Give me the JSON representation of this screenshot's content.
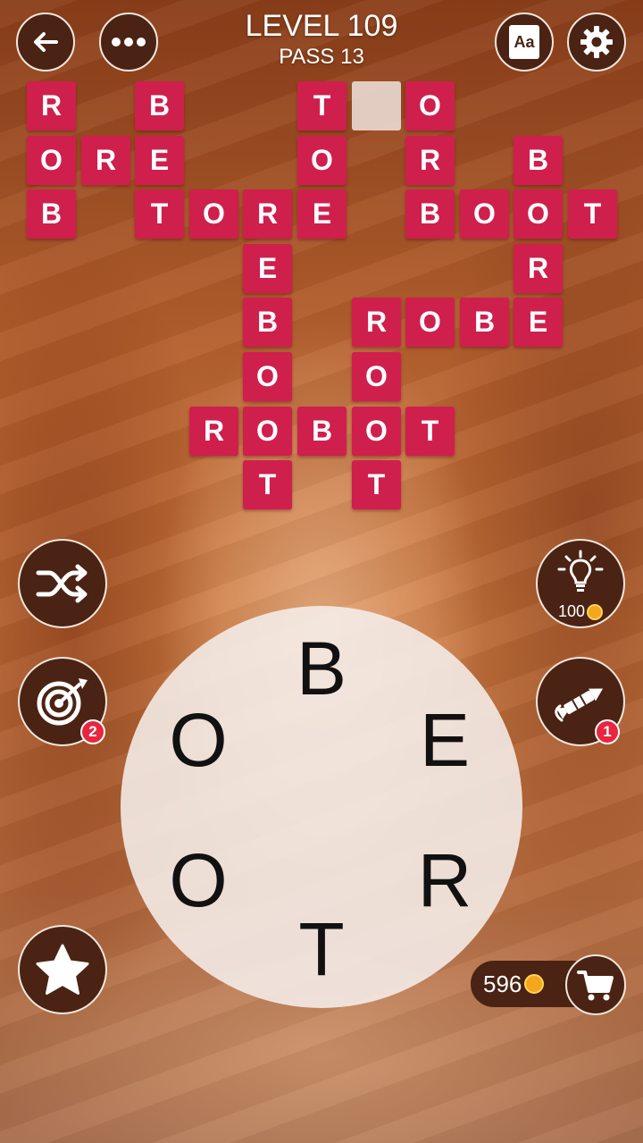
{
  "header": {
    "level_label": "LEVEL 109",
    "pass_label": "PASS 13"
  },
  "icons": {
    "back": "back-arrow-icon",
    "menu": "more-dots-icon",
    "dictionary": "dictionary-icon",
    "settings": "gear-icon",
    "shuffle": "shuffle-icon",
    "target": "target-icon",
    "hint": "lightbulb-icon",
    "rocket": "firework-rocket-icon",
    "star": "star-icon",
    "shop": "cart-icon",
    "coin": "coin-icon"
  },
  "dictionary_label": "Aa",
  "grid": {
    "tile_color": "#cf1f4d",
    "tiles": [
      {
        "row": 0,
        "col": 0,
        "letter": "R"
      },
      {
        "row": 0,
        "col": 2,
        "letter": "B"
      },
      {
        "row": 0,
        "col": 5,
        "letter": "T"
      },
      {
        "row": 0,
        "col": 6,
        "letter": "",
        "revealed": false
      },
      {
        "row": 0,
        "col": 7,
        "letter": "O"
      },
      {
        "row": 1,
        "col": 0,
        "letter": "O"
      },
      {
        "row": 1,
        "col": 1,
        "letter": "R"
      },
      {
        "row": 1,
        "col": 2,
        "letter": "E"
      },
      {
        "row": 1,
        "col": 5,
        "letter": "O"
      },
      {
        "row": 1,
        "col": 7,
        "letter": "R"
      },
      {
        "row": 1,
        "col": 9,
        "letter": "B"
      },
      {
        "row": 2,
        "col": 0,
        "letter": "B"
      },
      {
        "row": 2,
        "col": 2,
        "letter": "T"
      },
      {
        "row": 2,
        "col": 3,
        "letter": "O"
      },
      {
        "row": 2,
        "col": 4,
        "letter": "R"
      },
      {
        "row": 2,
        "col": 5,
        "letter": "E"
      },
      {
        "row": 2,
        "col": 7,
        "letter": "B"
      },
      {
        "row": 2,
        "col": 8,
        "letter": "O"
      },
      {
        "row": 2,
        "col": 9,
        "letter": "O"
      },
      {
        "row": 2,
        "col": 10,
        "letter": "T"
      },
      {
        "row": 3,
        "col": 4,
        "letter": "E"
      },
      {
        "row": 3,
        "col": 9,
        "letter": "R"
      },
      {
        "row": 4,
        "col": 4,
        "letter": "B"
      },
      {
        "row": 4,
        "col": 6,
        "letter": "R"
      },
      {
        "row": 4,
        "col": 7,
        "letter": "O"
      },
      {
        "row": 4,
        "col": 8,
        "letter": "B"
      },
      {
        "row": 4,
        "col": 9,
        "letter": "E"
      },
      {
        "row": 5,
        "col": 4,
        "letter": "O"
      },
      {
        "row": 5,
        "col": 6,
        "letter": "O"
      },
      {
        "row": 6,
        "col": 3,
        "letter": "R"
      },
      {
        "row": 6,
        "col": 4,
        "letter": "O"
      },
      {
        "row": 6,
        "col": 5,
        "letter": "B"
      },
      {
        "row": 6,
        "col": 6,
        "letter": "O"
      },
      {
        "row": 6,
        "col": 7,
        "letter": "T"
      },
      {
        "row": 7,
        "col": 4,
        "letter": "T"
      },
      {
        "row": 7,
        "col": 6,
        "letter": "T"
      }
    ]
  },
  "wheel_letters": [
    "B",
    "E",
    "R",
    "T",
    "O",
    "O"
  ],
  "powerups": {
    "target_count": "2",
    "rocket_count": "1",
    "hint_cost": "100"
  },
  "coins": "596"
}
